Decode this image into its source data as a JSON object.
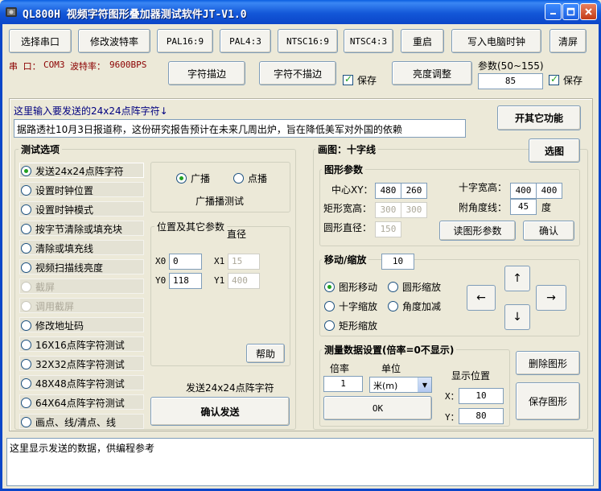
{
  "window": {
    "title": "QL800H 视频字符图形叠加器测试软件JT-V1.0",
    "controls": [
      "minimize",
      "maximize",
      "close"
    ]
  },
  "toolbar": {
    "select_port": "选择串口",
    "change_baud": "修改波特率",
    "pal16_9": "PAL16:9",
    "pal4_3": "PAL4:3",
    "ntsc16_9": "NTSC16:9",
    "ntsc4_3": "NTSC4:3",
    "restart": "重启",
    "write_clock": "写入电脑时钟",
    "clear_screen": "清屏"
  },
  "status": {
    "port_label": "串 口：",
    "port_value": "COM3",
    "baud_label": "波特率：",
    "baud_value": "9600BPS"
  },
  "row2": {
    "char_outline": "字符描边",
    "char_no_outline": "字符不描边",
    "save1": "保存",
    "brightness": "亮度调整",
    "param_label": "参数(50~155)",
    "param_value": "85",
    "save2": "保存"
  },
  "input_area": {
    "prompt": "这里输入要发送的24x24点阵字符↓",
    "text": "据路透社10月3日报道称，这份研究报告预计在未来几周出炉，旨在降低美军对外国的依赖",
    "other_func": "开其它功能"
  },
  "test_options": {
    "title": "测试选项",
    "items": [
      {
        "label": "发送24x24点阵字符",
        "selected": true,
        "enabled": true
      },
      {
        "label": "设置时钟位置",
        "selected": false,
        "enabled": true
      },
      {
        "label": "设置时钟模式",
        "selected": false,
        "enabled": true
      },
      {
        "label": "按字节清除或填充块",
        "selected": false,
        "enabled": true
      },
      {
        "label": "清除或填充线",
        "selected": false,
        "enabled": true
      },
      {
        "label": "视频扫描线亮度",
        "selected": false,
        "enabled": true
      },
      {
        "label": "截屏",
        "selected": false,
        "enabled": false
      },
      {
        "label": "调用截屏",
        "selected": false,
        "enabled": false
      },
      {
        "label": "修改地址码",
        "selected": false,
        "enabled": true
      },
      {
        "label": "16X16点阵字符测试",
        "selected": false,
        "enabled": true
      },
      {
        "label": "32X32点阵字符测试",
        "selected": false,
        "enabled": true
      },
      {
        "label": "48X48点阵字符测试",
        "selected": false,
        "enabled": true
      },
      {
        "label": "64X64点阵字符测试",
        "selected": false,
        "enabled": true
      },
      {
        "label": "画点、线/清点、线",
        "selected": false,
        "enabled": true
      }
    ],
    "broadcast": "广播",
    "point_cast": "点播",
    "broadcast_test": "广播播测试",
    "pos_group": "位置及其它参数",
    "diameter": "直径",
    "x0_label": "X0",
    "x0_value": "0",
    "y0_label": "Y0",
    "y0_value": "118",
    "x1_label": "X1",
    "x1_value": "15",
    "y1_label": "Y1",
    "y1_value": "400",
    "help": "帮助",
    "send_label": "发送24x24点阵字符",
    "confirm_send": "确认发送"
  },
  "drawing": {
    "title": "画图：十字线",
    "select_shape": "选图",
    "shape_params": "图形参数",
    "center_label": "中心XY：",
    "center_x": "480",
    "center_y": "260",
    "cross_wh_label": "十字宽高：",
    "cross_w": "400",
    "cross_h": "400",
    "rect_wh_label": "矩形宽高：",
    "rect_w": "300",
    "rect_h": "300",
    "angle_label": "附角度线：",
    "angle_value": "45",
    "angle_unit": "度",
    "circle_label": "圆形直径：",
    "circle_value": "150",
    "read_params": "读图形参数",
    "confirm": "确认",
    "move_zoom": "移动/缩放",
    "move_zoom_value": "10",
    "shape_move": "图形移动",
    "circle_zoom": "圆形缩放",
    "cross_zoom": "十字缩放",
    "angle_inc": "角度加减",
    "rect_zoom": "矩形缩放",
    "arrow_up": "↑",
    "arrow_left": "←",
    "arrow_right": "→",
    "arrow_down": "↓",
    "measure_title": "测量数据设置(倍率=0不显示)",
    "ratio_label": "倍率",
    "ratio_value": "1",
    "unit_label": "单位",
    "unit_value": "米(m)",
    "display_pos": "显示位置",
    "x_label": "X：",
    "x_value": "10",
    "y_label": "Y：",
    "y_value": "80",
    "ok": "OK",
    "delete_shape": "删除图形",
    "save_shape": "保存图形"
  },
  "output": {
    "text": "这里显示发送的数据，供编程参考"
  }
}
